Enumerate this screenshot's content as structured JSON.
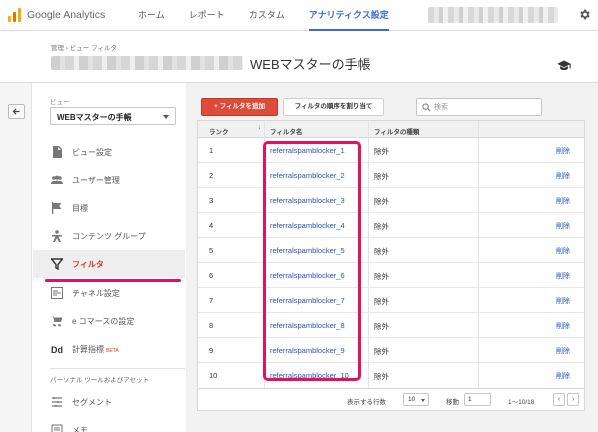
{
  "topbar": {
    "logo_text": "Google Analytics",
    "nav": [
      "ホーム",
      "レポート",
      "カスタム",
      "アナリティクス設定"
    ],
    "active_nav_index": 3
  },
  "header": {
    "breadcrumb": "管理 › ビュー フィルタ",
    "title": "WEBマスターの手帳"
  },
  "sidebar": {
    "view_label": "ビュー",
    "view_selected": "WEBマスターの手帳",
    "items": [
      {
        "label": "ビュー設定",
        "icon": "document-icon"
      },
      {
        "label": "ユーザー管理",
        "icon": "users-icon"
      },
      {
        "label": "目標",
        "icon": "flag-icon"
      },
      {
        "label": "コンテンツ グループ",
        "icon": "person-icon"
      },
      {
        "label": "フィルタ",
        "icon": "filter-icon",
        "active": true
      },
      {
        "label": "チャネル設定",
        "icon": "channel-icon"
      },
      {
        "label": "e コマースの設定",
        "icon": "cart-icon"
      },
      {
        "label": "計算指標",
        "icon": "dd-icon",
        "badge": "BETA"
      }
    ],
    "section_label": "パーソナル ツールおよびアセット",
    "section_items": [
      {
        "label": "セグメント",
        "icon": "segment-icon"
      },
      {
        "label": "メモ",
        "icon": "memo-icon"
      }
    ]
  },
  "toolbar": {
    "add_filter_label": "+ フィルタを追加",
    "order_label": "フィルタの順序を割り当て",
    "search_placeholder": "検索"
  },
  "table": {
    "columns": [
      "ランク",
      "フィルタ名",
      "フィルタの種類"
    ],
    "rows": [
      {
        "rank": "1",
        "name": "referralspamblocker_1",
        "type": "除外",
        "action": "削除"
      },
      {
        "rank": "2",
        "name": "referralspamblocker_2",
        "type": "除外",
        "action": "削除"
      },
      {
        "rank": "3",
        "name": "referralspamblocker_3",
        "type": "除外",
        "action": "削除"
      },
      {
        "rank": "4",
        "name": "referralspamblocker_4",
        "type": "除外",
        "action": "削除"
      },
      {
        "rank": "5",
        "name": "referralspamblocker_5",
        "type": "除外",
        "action": "削除"
      },
      {
        "rank": "6",
        "name": "referralspamblocker_6",
        "type": "除外",
        "action": "削除"
      },
      {
        "rank": "7",
        "name": "referralspamblocker_7",
        "type": "除外",
        "action": "削除"
      },
      {
        "rank": "8",
        "name": "referralspamblocker_8",
        "type": "除外",
        "action": "削除"
      },
      {
        "rank": "9",
        "name": "referralspamblocker_9",
        "type": "除外",
        "action": "削除"
      },
      {
        "rank": "10",
        "name": "referralspamblocker_10",
        "type": "除外",
        "action": "削除"
      }
    ]
  },
  "pager": {
    "rows_label": "表示する行数",
    "rows_value": "10",
    "goto_label": "移動",
    "goto_value": "1",
    "range": "1～10/18",
    "prev": "‹",
    "next": "›"
  },
  "colors": {
    "accent_blue": "#3a6bd8",
    "add_button_red": "#dd4b39",
    "highlight_pink": "#e5115e",
    "link_blue": "#2a52be"
  }
}
